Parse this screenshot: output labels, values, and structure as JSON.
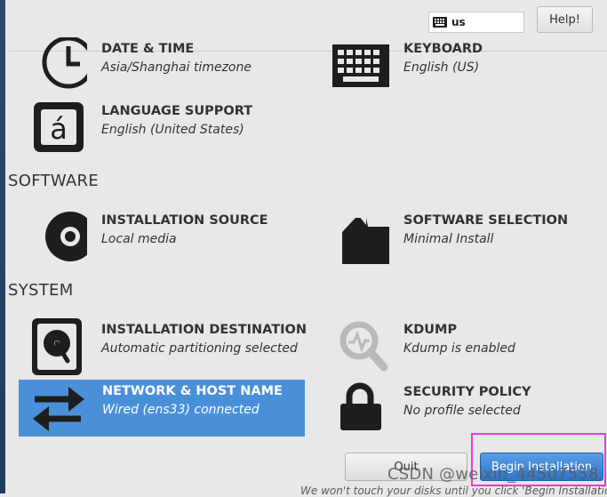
{
  "header": {
    "keyboard_layout": "us",
    "help_label": "Help!"
  },
  "localization": {
    "items": [
      {
        "title": "DATE & TIME",
        "status": "Asia/Shanghai timezone",
        "icon": "clock-icon"
      },
      {
        "title": "KEYBOARD",
        "status": "English (US)",
        "icon": "keyboard-icon"
      },
      {
        "title": "LANGUAGE SUPPORT",
        "status": "English (United States)",
        "icon": "language-icon"
      }
    ]
  },
  "software": {
    "section_label": "SOFTWARE",
    "items": [
      {
        "title": "INSTALLATION SOURCE",
        "status": "Local media",
        "icon": "disc-icon"
      },
      {
        "title": "SOFTWARE SELECTION",
        "status": "Minimal Install",
        "icon": "package-icon"
      }
    ]
  },
  "system": {
    "section_label": "SYSTEM",
    "items": [
      {
        "title": "INSTALLATION DESTINATION",
        "status": "Automatic partitioning selected",
        "icon": "harddisk-icon"
      },
      {
        "title": "KDUMP",
        "status": "Kdump is enabled",
        "icon": "search-icon"
      },
      {
        "title": "NETWORK & HOST NAME",
        "status": "Wired (ens33) connected",
        "icon": "network-arrows-icon"
      },
      {
        "title": "SECURITY POLICY",
        "status": "No profile selected",
        "icon": "lock-icon"
      }
    ]
  },
  "footer": {
    "quit_label": "Quit",
    "begin_label": "Begin Installation",
    "note": "We won't touch your disks until you click 'Begin Installation'."
  },
  "watermark": "CSDN @weixin_44507558",
  "colors": {
    "background": "#e8e8e7",
    "selected": "#4a90d9",
    "begin_button": "#3b82d4",
    "highlight": "#e040e0"
  }
}
